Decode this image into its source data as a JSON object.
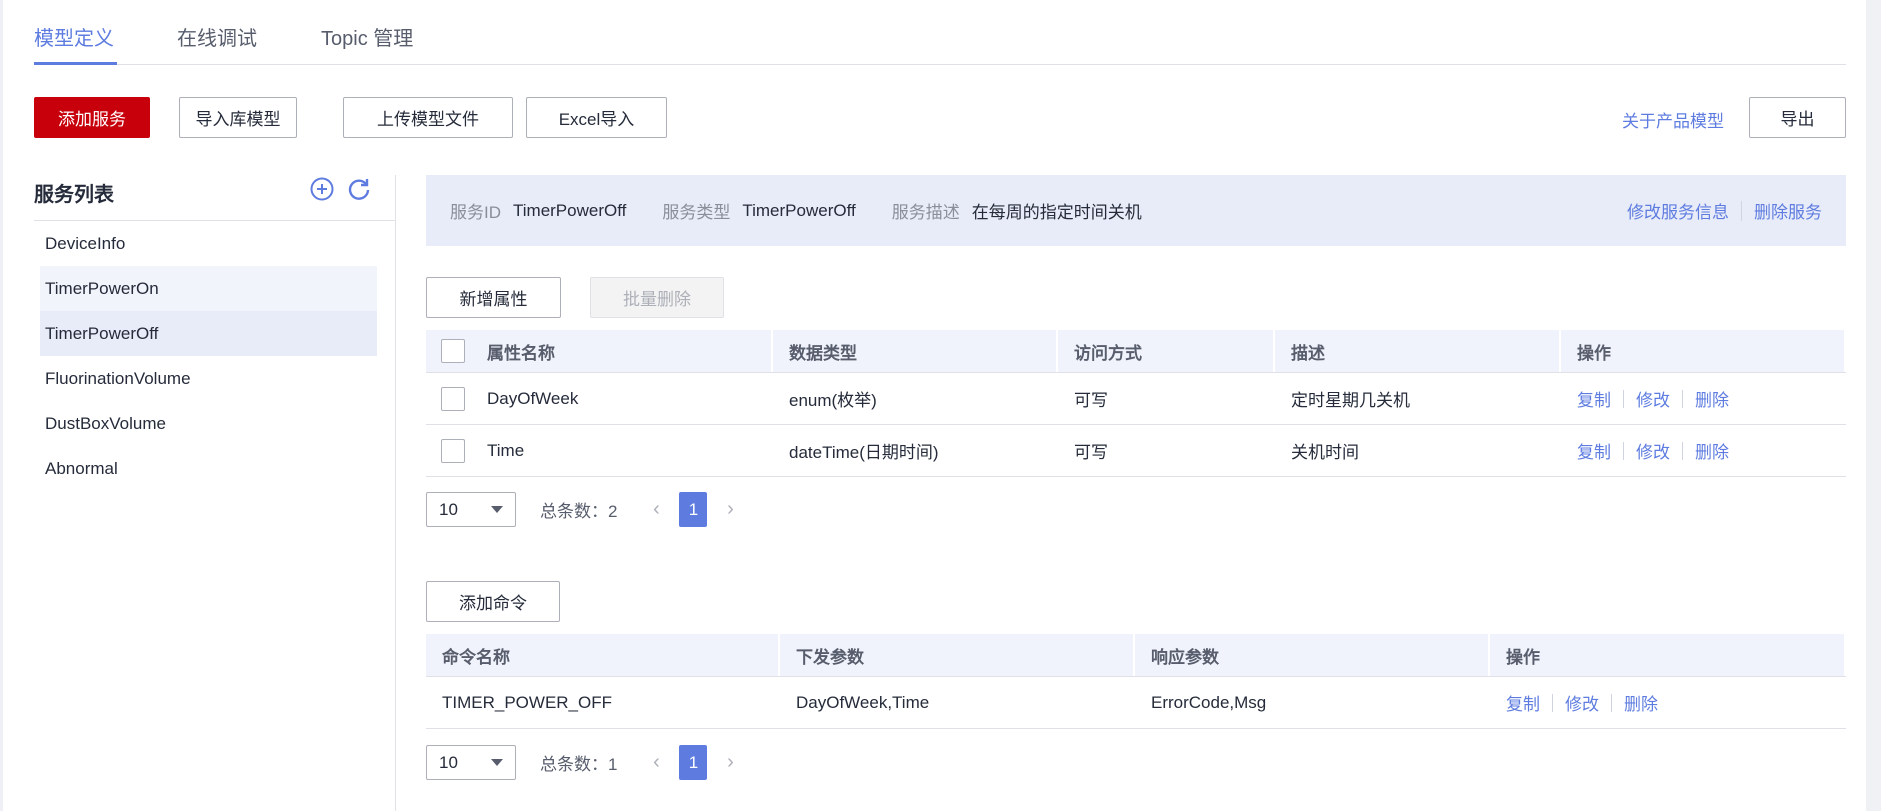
{
  "tabs": [
    {
      "label": "模型定义",
      "active": true
    },
    {
      "label": "在线调试"
    },
    {
      "label": "Topic 管理"
    }
  ],
  "toolbar": {
    "add_service": "添加服务",
    "import_lib": "导入库模型",
    "upload_file": "上传模型文件",
    "excel_import": "Excel导入",
    "about": "关于产品模型",
    "export": "导出"
  },
  "sidebar": {
    "title": "服务列表",
    "items": [
      "DeviceInfo",
      "TimerPowerOn",
      "TimerPowerOff",
      "FluorinationVolume",
      "DustBoxVolume",
      "Abnormal"
    ],
    "selected": "TimerPowerOff"
  },
  "service": {
    "id_label": "服务ID",
    "id": "TimerPowerOff",
    "type_label": "服务类型",
    "type": "TimerPowerOff",
    "desc_label": "服务描述",
    "desc": "在每周的指定时间关机",
    "edit": "修改服务信息",
    "delete": "删除服务"
  },
  "properties": {
    "add": "新增属性",
    "batch_delete": "批量删除",
    "headers": [
      "属性名称",
      "数据类型",
      "访问方式",
      "描述",
      "操作"
    ],
    "rows": [
      {
        "name": "DayOfWeek",
        "type": "enum(枚举)",
        "access": "可写",
        "desc": "定时星期几关机"
      },
      {
        "name": "Time",
        "type": "dateTime(日期时间)",
        "access": "可写",
        "desc": "关机时间"
      }
    ],
    "ops": [
      "复制",
      "修改",
      "删除"
    ],
    "page_size": "10",
    "total": "总条数：2",
    "page": "1"
  },
  "commands": {
    "add": "添加命令",
    "headers": [
      "命令名称",
      "下发参数",
      "响应参数",
      "操作"
    ],
    "rows": [
      {
        "name": "TIMER_POWER_OFF",
        "params": "DayOfWeek,Time",
        "response": "ErrorCode,Msg"
      }
    ],
    "ops": [
      "复制",
      "修改",
      "删除"
    ],
    "page_size": "10",
    "total": "总条数：1",
    "page": "1"
  },
  "colors": {
    "accent": "#5e7ce0",
    "primary": "#c7000b"
  }
}
